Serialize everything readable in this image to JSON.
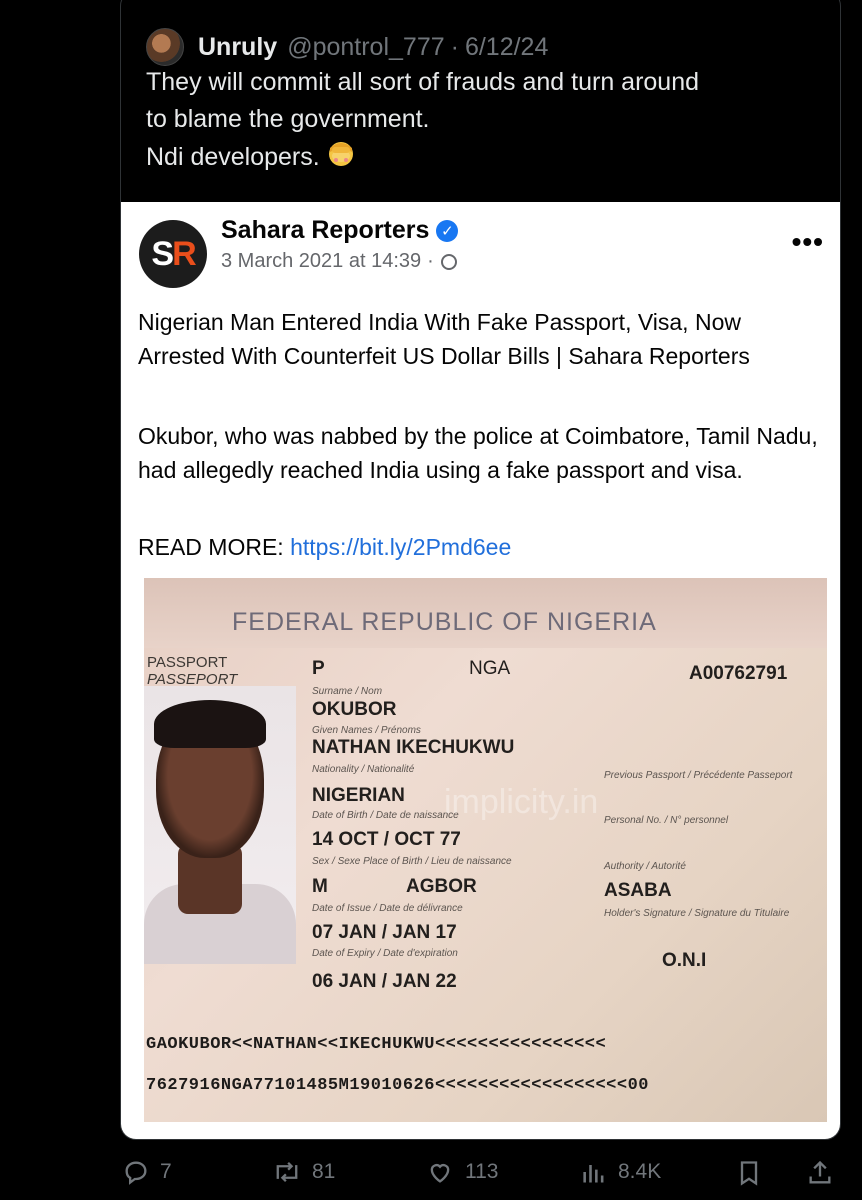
{
  "quote": {
    "name": "Unruly",
    "handle": "@pontrol_777",
    "separator": "·",
    "date": "6/12/24",
    "text": "They will commit all sort of frauds and turn around\nto blame the government.\nNdi developers.",
    "emoji": "face-palm-emoji"
  },
  "fb": {
    "logo_s": "S",
    "logo_r": "R",
    "page_name": "Sahara Reporters",
    "verified": "✓",
    "timestamp": "3 March 2021 at 14:39",
    "dot": "·",
    "more": "•••",
    "headline": "Nigerian Man Entered India With Fake Passport, Visa, Now Arrested With Counterfeit US Dollar Bills | Sahara Reporters",
    "body": "Okubor, who was nabbed by the police at Coimbatore, Tamil Nadu, had allegedly reached India using a fake passport and visa.",
    "readmore_label": "READ MORE: ",
    "readmore_link": "https://bit.ly/2Pmd6ee"
  },
  "passport": {
    "republic": "FEDERAL REPUBLIC OF NIGERIA",
    "type_label_1": "PASSPORT",
    "type_label_2": "PASSEPORT",
    "type": "P",
    "country_code": "NGA",
    "passport_no": "A00762791",
    "surname": "OKUBOR",
    "given_names": "NATHAN IKECHUKWU",
    "nationality": "NIGERIAN",
    "dob": "14 OCT / OCT 77",
    "sex": "M",
    "place_of_birth": "AGBOR",
    "issue_date": "07 JAN / JAN 17",
    "expiry_date": "06 JAN / JAN 22",
    "authority": "ASABA",
    "signature": "O.N.I",
    "watermark": "implicity.in",
    "label_surname": "Surname / Nom",
    "label_given": "Given Names / Prénoms",
    "label_nationality": "Nationality / Nationalité",
    "label_dob": "Date of Birth / Date de naissance",
    "label_sex": "Sex / Sexe   Place of Birth / Lieu de naissance",
    "label_issue": "Date of Issue / Date de délivrance",
    "label_expiry": "Date of Expiry / Date d'expiration",
    "label_prev": "Previous Passport / Précédente Passeport",
    "label_personal": "Personal No. / N° personnel",
    "label_authority": "Authority / Autorité",
    "label_holder_sig": "Holder's Signature / Signature du Titulaire",
    "mrz_1": "GAOKUBOR<<NATHAN<<IKECHUKWU<<<<<<<<<<<<<<<<",
    "mrz_2": "7627916NGA77101485M19010626<<<<<<<<<<<<<<<<<<00"
  },
  "actions": {
    "replies": "7",
    "reposts": "81",
    "likes": "113",
    "views": "8.4K"
  },
  "colors": {
    "background": "#000000",
    "muted": "#71767b",
    "link": "#216fdb",
    "verified": "#1877f2",
    "logo_red": "#e94e1b"
  }
}
